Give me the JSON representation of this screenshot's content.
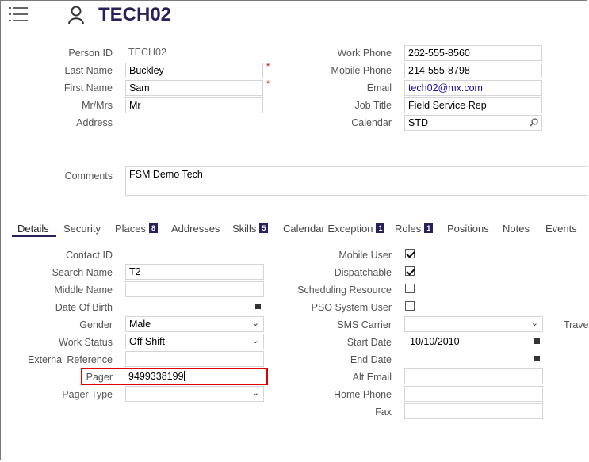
{
  "header": {
    "title": "TECH02"
  },
  "top": {
    "person_id": {
      "label": "Person ID",
      "value": "TECH02"
    },
    "last_name": {
      "label": "Last Name",
      "value": "Buckley"
    },
    "first_name": {
      "label": "First Name",
      "value": "Sam"
    },
    "mr_mrs": {
      "label": "Mr/Mrs",
      "value": "Mr"
    },
    "address": {
      "label": "Address"
    },
    "work_phone": {
      "label": "Work Phone",
      "value": "262-555-8560"
    },
    "mobile_phone": {
      "label": "Mobile Phone",
      "value": "214-555-8798"
    },
    "email": {
      "label": "Email",
      "value": "tech02@mx.com"
    },
    "job_title": {
      "label": "Job Title",
      "value": "Field Service Rep"
    },
    "calendar": {
      "label": "Calendar",
      "value": "STD"
    },
    "comments": {
      "label": "Comments",
      "value": "FSM Demo Tech"
    },
    "required_mark": "*"
  },
  "tabs": [
    {
      "label": "Details"
    },
    {
      "label": "Security"
    },
    {
      "label": "Places",
      "badge": "8"
    },
    {
      "label": "Addresses"
    },
    {
      "label": "Skills",
      "badge": "5"
    },
    {
      "label": "Calendar Exception",
      "badge": "1"
    },
    {
      "label": "Roles",
      "badge": "1"
    },
    {
      "label": "Positions"
    },
    {
      "label": "Notes"
    },
    {
      "label": "Events"
    }
  ],
  "details_left": {
    "contact_id": {
      "label": "Contact ID"
    },
    "search_name": {
      "label": "Search Name",
      "value": "T2"
    },
    "middle_name": {
      "label": "Middle Name",
      "value": ""
    },
    "date_of_birth": {
      "label": "Date Of Birth",
      "value": ""
    },
    "gender": {
      "label": "Gender",
      "value": "Male"
    },
    "work_status": {
      "label": "Work Status",
      "value": "Off Shift"
    },
    "external_reference": {
      "label": "External Reference",
      "value": ""
    },
    "pager": {
      "label": "Pager",
      "value": "9499338199"
    },
    "pager_type": {
      "label": "Pager Type",
      "value": ""
    }
  },
  "details_right": {
    "mobile_user": {
      "label": "Mobile User",
      "checked": true
    },
    "dispatchable": {
      "label": "Dispatchable",
      "checked": true
    },
    "scheduling_resource": {
      "label": "Scheduling Resource",
      "checked": false
    },
    "pso_system_user": {
      "label": "PSO System User",
      "checked": false
    },
    "sms_carrier": {
      "label": "SMS Carrier",
      "value": ""
    },
    "start_date": {
      "label": "Start Date",
      "value": "10/10/2010"
    },
    "end_date": {
      "label": "End Date",
      "value": ""
    },
    "alt_email": {
      "label": "Alt Email",
      "value": ""
    },
    "home_phone": {
      "label": "Home Phone",
      "value": ""
    },
    "fax": {
      "label": "Fax",
      "value": ""
    },
    "travel_cut": {
      "label": "Trave"
    }
  },
  "icons": {
    "menu": "list-menu-icon",
    "person": "person-icon",
    "search": "search-icon",
    "dropdown": "chevron-down-icon",
    "calendar": "calendar-icon"
  },
  "colors": {
    "title": "#2b1f5c",
    "active_tab": "#2b1f5c",
    "highlight": "#e00000",
    "link": "#1a0dab"
  }
}
